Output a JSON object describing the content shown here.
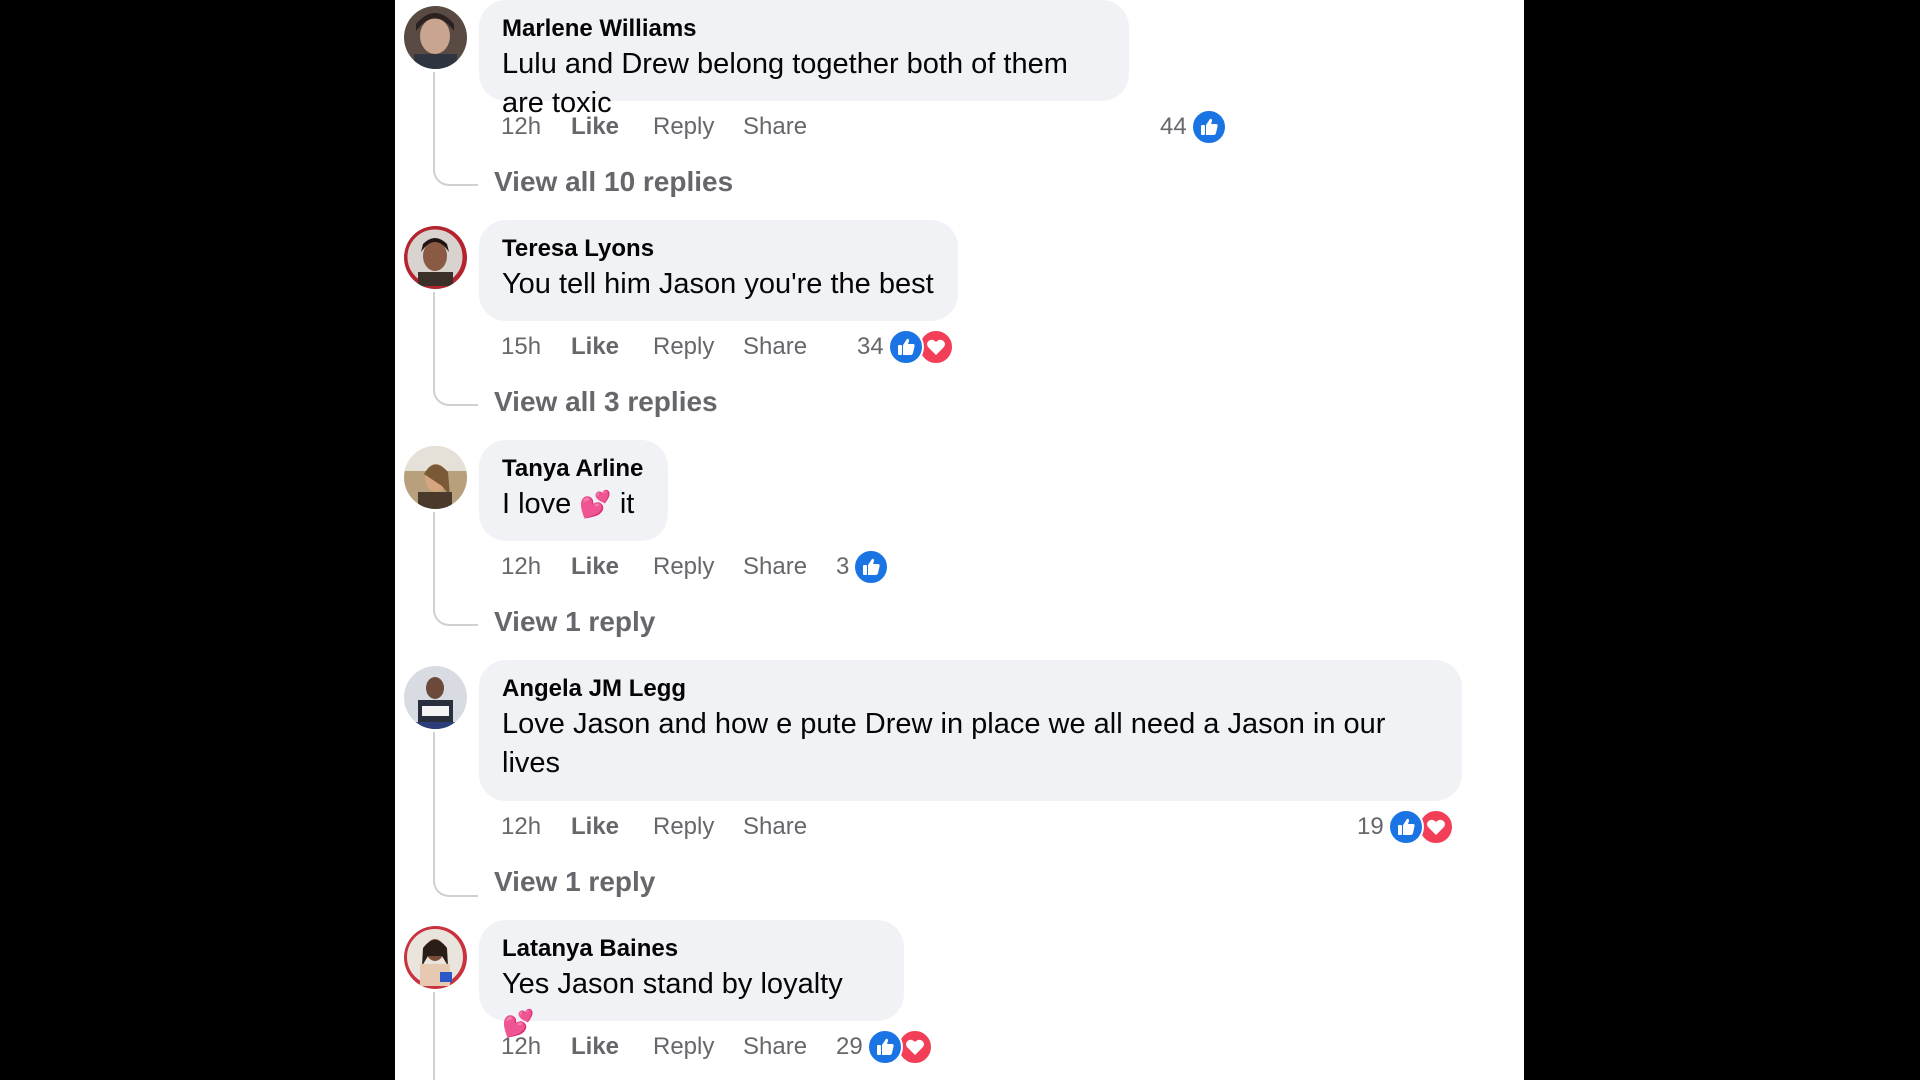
{
  "comments": [
    {
      "author": "Marlene Williams",
      "text": "Lulu and Drew belong together both of them are toxic",
      "time": "12h",
      "like": "Like",
      "reply": "Reply",
      "share": "Share",
      "reaction_count": "44",
      "reactions": [
        "like-icon"
      ],
      "view_replies": "View all 10 replies"
    },
    {
      "author": "Teresa Lyons",
      "text": "You tell him Jason you're the best",
      "time": "15h",
      "like": "Like",
      "reply": "Reply",
      "share": "Share",
      "reaction_count": "34",
      "reactions": [
        "like-icon",
        "love-icon"
      ],
      "view_replies": "View all 3 replies"
    },
    {
      "author": "Tanya Arline",
      "text_before": "I love",
      "emoji": "💕",
      "text_after": "it",
      "time": "12h",
      "like": "Like",
      "reply": "Reply",
      "share": "Share",
      "reaction_count": "3",
      "reactions": [
        "like-icon"
      ],
      "view_replies": "View 1 reply"
    },
    {
      "author": "Angela JM Legg",
      "text_line1": "Love Jason and how e pute Drew in place we all need a Jason in our",
      "text_line2": "lives",
      "time": "12h",
      "like": "Like",
      "reply": "Reply",
      "share": "Share",
      "reaction_count": "19",
      "reactions": [
        "like-icon",
        "love-icon"
      ],
      "view_replies": "View 1 reply"
    },
    {
      "author": "Latanya Baines",
      "text_before": "Yes Jason stand by loyalty",
      "emoji": "💕",
      "time": "12h",
      "like": "Like",
      "reply": "Reply",
      "share": "Share",
      "reaction_count": "29",
      "reactions": [
        "like-icon",
        "love-icon"
      ]
    }
  ],
  "colors": {
    "page_background": "#000000",
    "panel_background": "#ffffff",
    "bubble_background": "#f0f2f5",
    "secondary_text": "#65676b",
    "like_blue": "#1b74e4",
    "love_red": "#f33e58"
  }
}
